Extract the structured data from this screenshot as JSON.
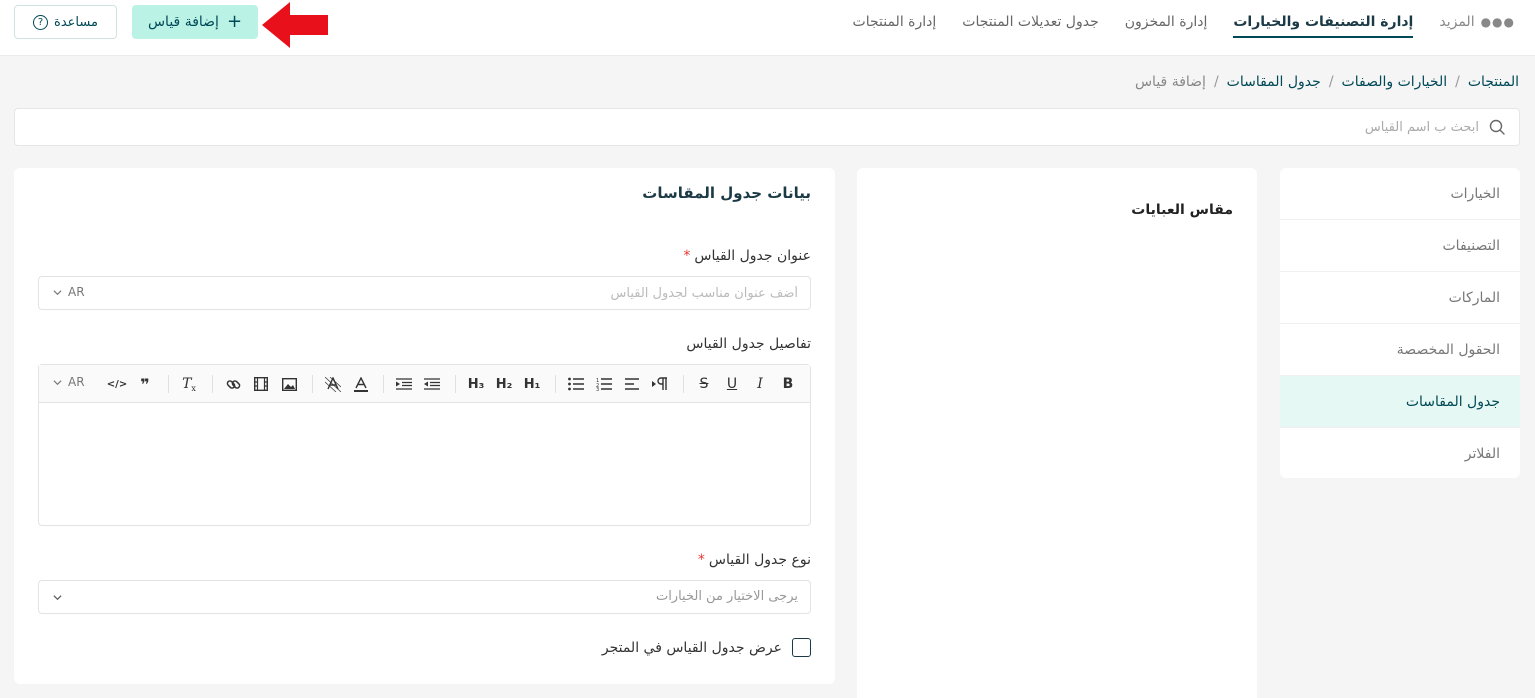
{
  "nav": {
    "items": [
      {
        "label": "إدارة المنتجات",
        "active": false
      },
      {
        "label": "جدول تعديلات المنتجات",
        "active": false
      },
      {
        "label": "إدارة المخزون",
        "active": false
      },
      {
        "label": "إدارة التصنيفات والخيارات",
        "active": true
      }
    ],
    "more_label": "المزيد",
    "more_icon": "ellipsis-icon"
  },
  "actions": {
    "add_label": "إضافة قياس",
    "add_icon": "plus-icon",
    "help_label": "مساعدة",
    "help_icon": "question-circle-icon"
  },
  "breadcrumb": [
    {
      "label": "المنتجات",
      "link": true
    },
    {
      "label": "الخيارات والصفات",
      "link": true
    },
    {
      "label": "جدول المقاسات",
      "link": true
    },
    {
      "label": "إضافة قياس",
      "link": false
    }
  ],
  "search": {
    "placeholder": "ابحث ب اسم القياس",
    "value": "",
    "icon": "search-icon"
  },
  "sidebar": {
    "items": [
      {
        "label": "الخيارات",
        "active": false
      },
      {
        "label": "التصنيفات",
        "active": false
      },
      {
        "label": "الماركات",
        "active": false
      },
      {
        "label": "الحقول المخصصة",
        "active": false
      },
      {
        "label": "جدول المقاسات",
        "active": true
      },
      {
        "label": "الفلاتر",
        "active": false
      }
    ]
  },
  "middle_panel": {
    "title": "مقاس العبايات"
  },
  "form": {
    "title": "بيانات جدول المقاسات",
    "size_title": {
      "label": "عنوان جدول القياس",
      "required_mark": "*",
      "placeholder": "أضف عنوان مناسب لجدول القياس",
      "value": "",
      "lang": "AR"
    },
    "details": {
      "label": "تفاصيل جدول القياس",
      "lang": "AR",
      "content": ""
    },
    "type": {
      "label": "نوع جدول القياس",
      "required_mark": "*",
      "placeholder": "يرجى الاختيار من الخيارات"
    },
    "show_in_store": {
      "label": "عرض جدول القياس في المتجر",
      "checked": false
    }
  },
  "toolbar": {
    "bold": "B",
    "italic": "I",
    "underline": "U",
    "strike": "S",
    "h1": "H₁",
    "h2": "H₂",
    "h3": "H₃",
    "clear": "T",
    "quote": "❞",
    "code": "</>"
  },
  "colors": {
    "brand_dark": "#004956",
    "accent_mint": "#baf3e6",
    "active_bg": "#e6f8f4",
    "annotation_red": "#e8101a"
  }
}
